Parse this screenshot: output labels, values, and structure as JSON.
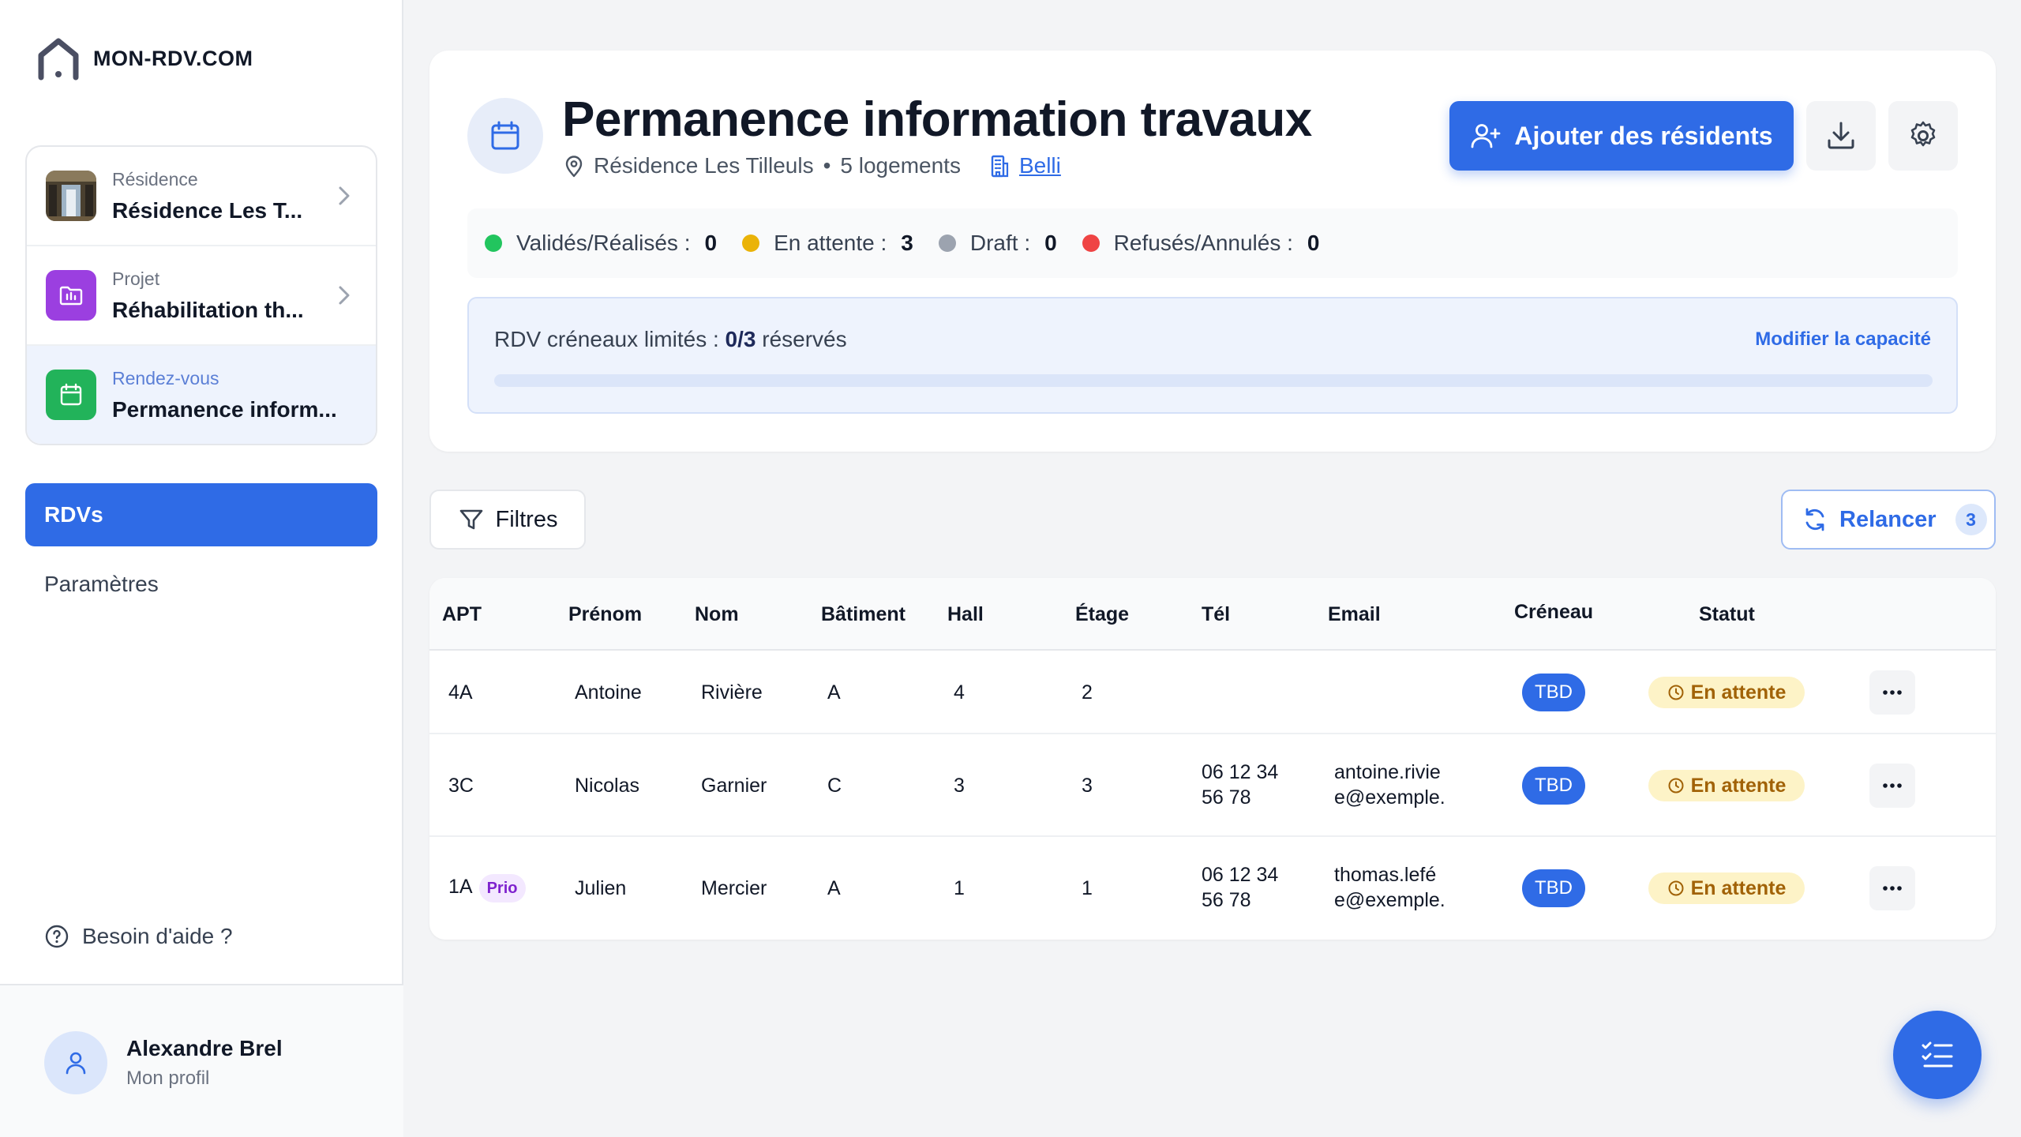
{
  "app": {
    "brand": "MON-RDV.COM"
  },
  "context": {
    "residence": {
      "label": "Résidence",
      "value": "Résidence Les T..."
    },
    "project": {
      "label": "Projet",
      "value": "Réhabilitation th..."
    },
    "appointment": {
      "label": "Rendez-vous",
      "value": "Permanence inform..."
    }
  },
  "nav": {
    "active": "RDVs",
    "settings": "Paramètres"
  },
  "help": "Besoin d'aide ?",
  "profile": {
    "name": "Alexandre Brel",
    "sub": "Mon profil"
  },
  "header": {
    "title": "Permanence information travaux",
    "residence": "Résidence Les Tilleuls",
    "separator": "•",
    "units": "5 logements",
    "building_link": "Belli",
    "add_button": "Ajouter des résidents"
  },
  "stats": [
    {
      "label": "Validés/Réalisés :",
      "value": "0",
      "color": "#22c55e"
    },
    {
      "label": "En attente :",
      "value": "3",
      "color": "#eab308"
    },
    {
      "label": "Draft :",
      "value": "0",
      "color": "#9ca3af"
    },
    {
      "label": "Refusés/Annulés :",
      "value": "0",
      "color": "#ef4444"
    }
  ],
  "capacity": {
    "prefix": "RDV créneaux limités :",
    "ratio": "0/3",
    "suffix": "réservés",
    "link": "Modifier la capacité",
    "reserved": 0,
    "total": 3
  },
  "toolbar": {
    "filters": "Filtres",
    "relancer": "Relancer",
    "relancer_count": "3"
  },
  "table": {
    "headers": [
      "APT",
      "Prénom",
      "Nom",
      "Bâtiment",
      "Hall",
      "Étage",
      "Tél",
      "Email",
      "Créneau",
      "Statut"
    ],
    "rows": [
      {
        "apt": "4A",
        "prio": "",
        "prenom": "Antoine",
        "nom": "Rivière",
        "batiment": "A",
        "hall": "4",
        "etage": "2",
        "tel1": "",
        "tel2": "",
        "email1": "",
        "email2": "",
        "creneau": "TBD",
        "statut": "En attente"
      },
      {
        "apt": "3C",
        "prio": "",
        "prenom": "Nicolas",
        "nom": "Garnier",
        "batiment": "C",
        "hall": "3",
        "etage": "3",
        "tel1": "06 12 34",
        "tel2": "56 78",
        "email1": "antoine.rivie",
        "email2": "e@exemple.",
        "creneau": "TBD",
        "statut": "En attente"
      },
      {
        "apt": "1A",
        "prio": "Prio",
        "prenom": "Julien",
        "nom": "Mercier",
        "batiment": "A",
        "hall": "1",
        "etage": "1",
        "tel1": "06 12 34",
        "tel2": "56 78",
        "email1": "thomas.lefé",
        "email2": "e@exemple.",
        "creneau": "TBD",
        "statut": "En attente"
      }
    ]
  },
  "colors": {
    "primary": "#2f6be6",
    "pending_bg": "#fdf3c7",
    "pending_text": "#a16207",
    "prio_bg": "#f3e8ff",
    "prio_text": "#7e22ce"
  }
}
